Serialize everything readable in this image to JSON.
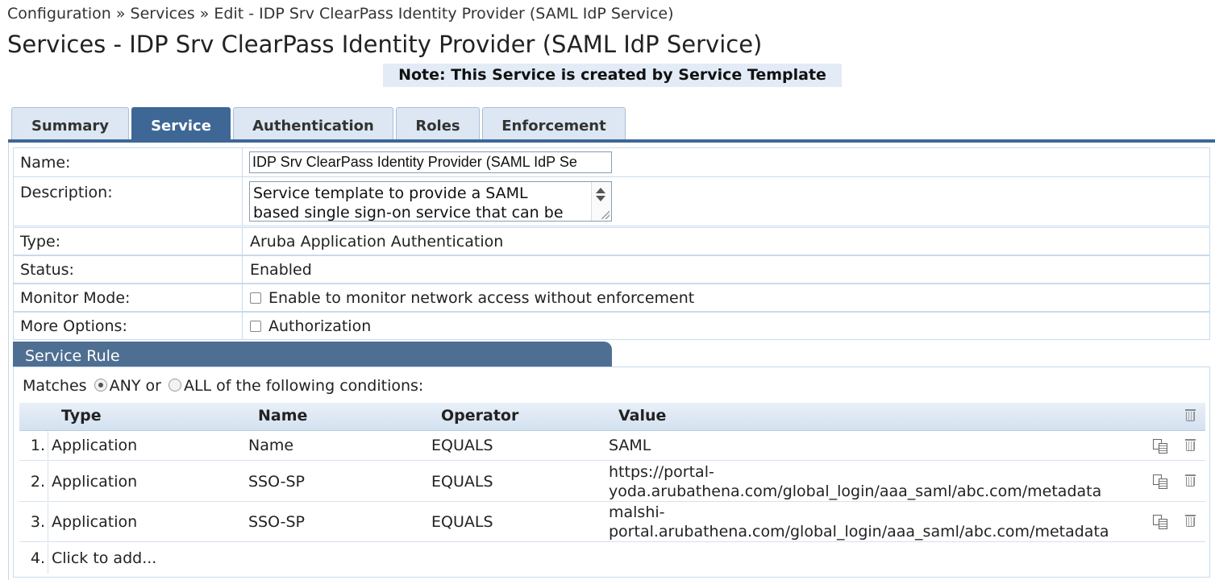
{
  "breadcrumb": "Configuration » Services » Edit - IDP Srv ClearPass Identity Provider (SAML IdP Service)",
  "page_title": "Services - IDP Srv ClearPass Identity Provider (SAML IdP Service)",
  "note": "Note: This Service is created by Service Template",
  "tabs": [
    {
      "label": "Summary",
      "active": false
    },
    {
      "label": "Service",
      "active": true
    },
    {
      "label": "Authentication",
      "active": false
    },
    {
      "label": "Roles",
      "active": false
    },
    {
      "label": "Enforcement",
      "active": false
    }
  ],
  "form": {
    "name_label": "Name:",
    "name_value": "IDP Srv ClearPass Identity Provider (SAML IdP Se",
    "description_label": "Description:",
    "description_line1": "Service template to provide a SAML",
    "description_line2": "based single sign-on service that can be",
    "type_label": "Type:",
    "type_value": "Aruba Application Authentication",
    "status_label": "Status:",
    "status_value": "Enabled",
    "monitor_label": "Monitor Mode:",
    "monitor_checkbox_label": "Enable to monitor network access without enforcement",
    "more_label": "More Options:",
    "more_checkbox_label": "Authorization"
  },
  "service_rule": {
    "title": "Service Rule",
    "matches_prefix": "Matches",
    "any_label": "ANY or",
    "all_label": "ALL of the following conditions:",
    "selected": "ANY",
    "columns": [
      "Type",
      "Name",
      "Operator",
      "Value"
    ],
    "rows": [
      {
        "num": "1.",
        "type": "Application",
        "name": "Name",
        "operator": "EQUALS",
        "value1": "SAML",
        "value2": ""
      },
      {
        "num": "2.",
        "type": "Application",
        "name": "SSO-SP",
        "operator": "EQUALS",
        "value1": "https://portal-",
        "value2": "yoda.arubathena.com/global_login/aaa_saml/abc.com/metadata"
      },
      {
        "num": "3.",
        "type": "Application",
        "name": "SSO-SP",
        "operator": "EQUALS",
        "value1": "malshi-",
        "value2": "portal.arubathena.com/global_login/aaa_saml/abc.com/metadata"
      }
    ],
    "add_num": "4.",
    "add_label": "Click to add..."
  },
  "colors": {
    "accent": "#3e6796",
    "tab_inactive": "#dde7f3",
    "section_header": "#4f6f92",
    "note_bg": "#e3ebf6"
  }
}
